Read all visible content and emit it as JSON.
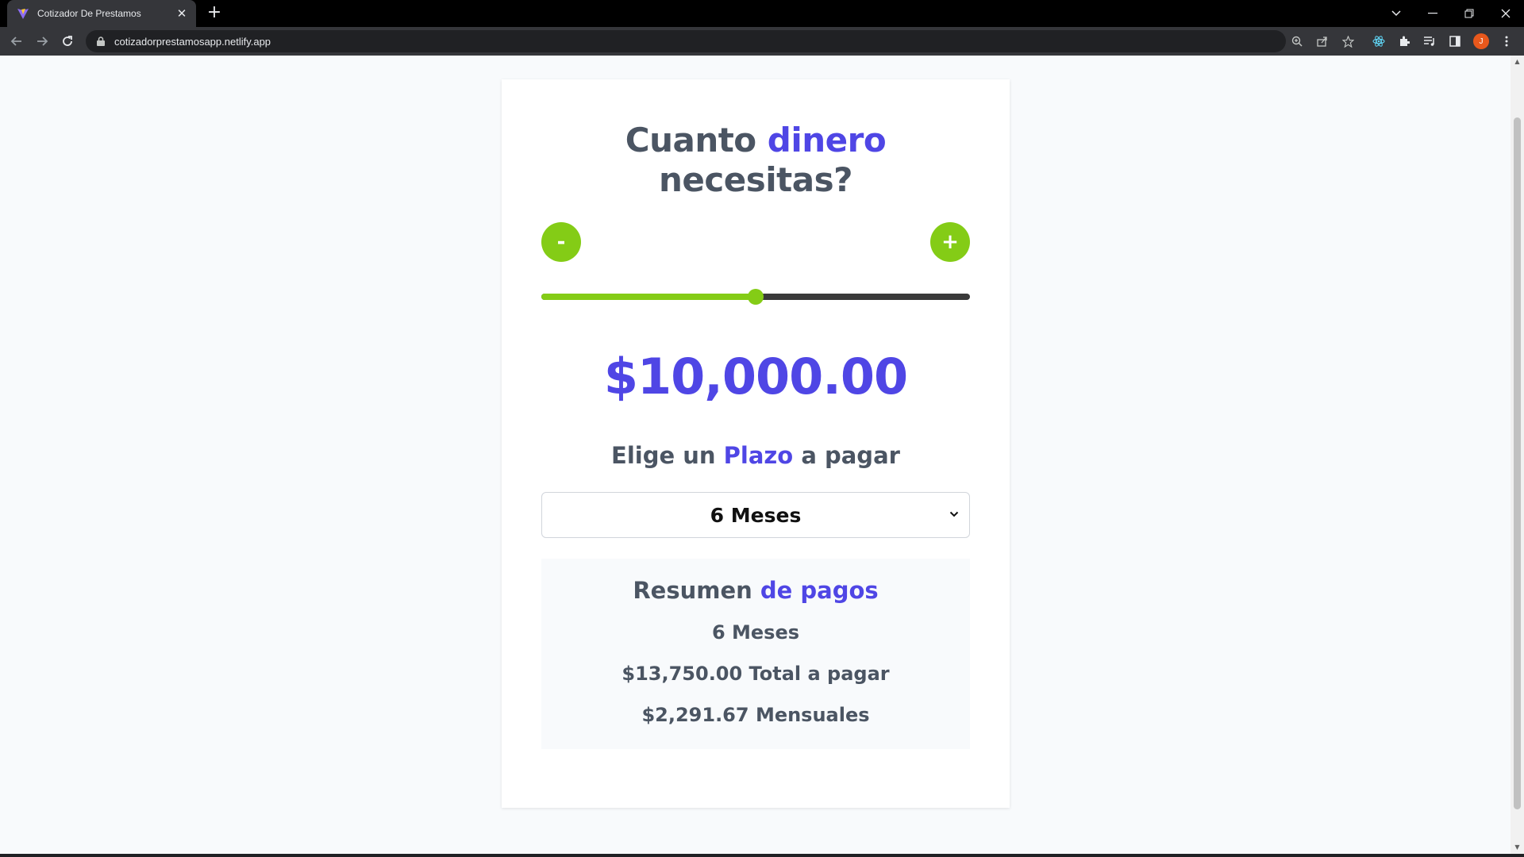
{
  "browser": {
    "tab_title": "Cotizador De Prestamos",
    "close_tab_glyph": "✕",
    "new_tab_glyph": "+",
    "url": "cotizadorprestamosapp.netlify.app",
    "avatar_initial": "J",
    "icons": [
      "back-icon",
      "forward-icon",
      "reload-icon",
      "lock-icon",
      "zoom-icon",
      "share-icon",
      "bookmark-star-icon",
      "react-devtools-icon",
      "extensions-icon",
      "media-icon",
      "side-panel-icon",
      "menu-icon",
      "minimize-icon",
      "restore-icon",
      "close-window-icon",
      "tab-search-icon"
    ]
  },
  "page": {
    "heading_part1": "Cuanto ",
    "heading_accent": "dinero",
    "heading_part2": "necesitas?",
    "decrease_label": "-",
    "increase_label": "+",
    "slider_fraction": 0.5,
    "amount": "$10,000.00",
    "plazo_part1": "Elige un ",
    "plazo_accent": "Plazo",
    "plazo_part2": " a pagar",
    "term_selected": "6 Meses",
    "summary": {
      "title_part1": "Resumen ",
      "title_accent": "de pagos",
      "months": "6 Meses",
      "total": "$13,750.00 Total a pagar",
      "monthly": "$2,291.67 Mensuales"
    }
  },
  "colors": {
    "accent": "#4f46e5",
    "green": "#84cc16",
    "text_gray": "#4b5563",
    "background": "#f8fafc"
  }
}
